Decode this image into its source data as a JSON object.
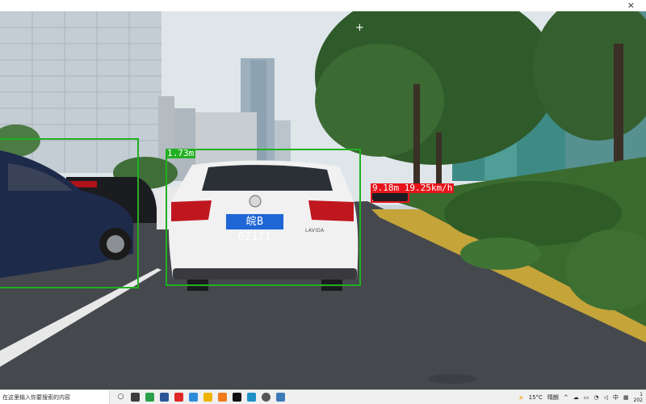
{
  "window": {
    "close_glyph": "×"
  },
  "frame": {
    "crosshair_glyph": "+"
  },
  "detections": {
    "left_car": {
      "label": ""
    },
    "center_car": {
      "label": "1.73m"
    },
    "far_car": {
      "label": "9.18m 19.25km/h"
    }
  },
  "center_car": {
    "plate": "皖B 0Z171",
    "model": "LAVIDA"
  },
  "taskbar": {
    "search_placeholder": "在这里输入你要搜索的内容",
    "apps": [
      "task-view",
      "photos",
      "word",
      "app-red",
      "app-q",
      "folder",
      "mail",
      "capcut",
      "edge",
      "python"
    ],
    "weather_temp": "15°C",
    "weather_text": "晴朗",
    "ime": "中",
    "clock_time": "1",
    "clock_date": "202"
  },
  "colors": {
    "box_green": "#22b022",
    "box_red": "#e8141a",
    "plate_blue": "#1f66d6"
  }
}
